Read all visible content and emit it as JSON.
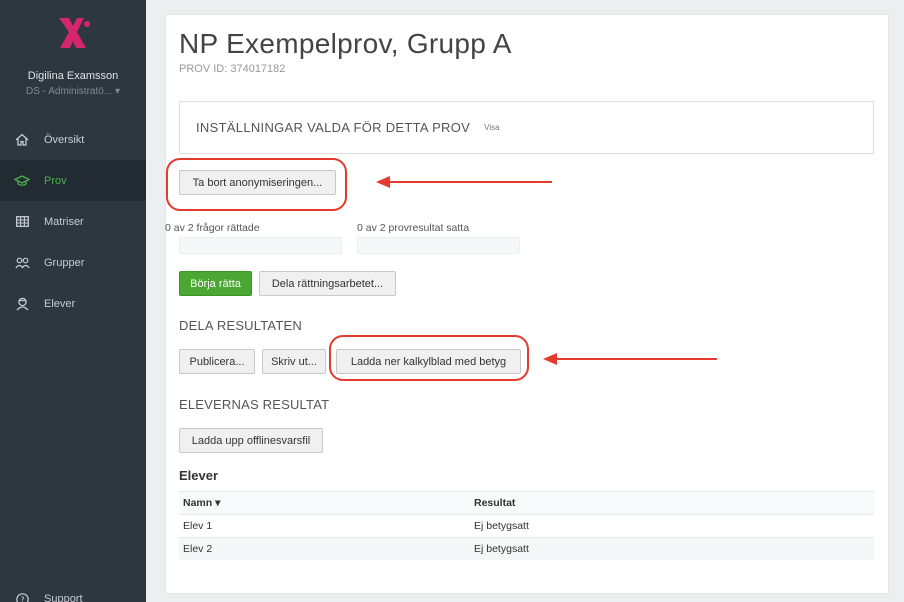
{
  "sidebar": {
    "user_name": "Digilina Examsson",
    "user_role": "DS - Administratö...",
    "items": [
      {
        "label": "Översikt",
        "icon": "home-icon",
        "active": false
      },
      {
        "label": "Prov",
        "icon": "graduation-cap-icon",
        "active": true
      },
      {
        "label": "Matriser",
        "icon": "grid-icon",
        "active": false
      },
      {
        "label": "Grupper",
        "icon": "group-icon",
        "active": false
      },
      {
        "label": "Elever",
        "icon": "student-icon",
        "active": false
      }
    ],
    "support_label": "Support"
  },
  "header": {
    "title": "NP Exempelprov, Grupp A",
    "subtitle": "PROV ID: 374017182"
  },
  "settings": {
    "title": "INSTÄLLNINGAR VALDA FÖR DETTA PROV",
    "link": "Visa"
  },
  "anonymize_button": "Ta bort anonymiseringen...",
  "progress": {
    "questions_label": "0 av 2 frågor rättade",
    "questions_fraction": 0,
    "results_label": "0 av 2 provresultat satta",
    "results_fraction": 0
  },
  "grading": {
    "start_button": "Börja rätta",
    "share_button": "Dela rättningsarbetet..."
  },
  "share_results": {
    "heading": "DELA RESULTATEN",
    "publish_button": "Publicera...",
    "print_button": "Skriv ut...",
    "download_button": "Ladda ner kalkylblad med betyg"
  },
  "student_results": {
    "heading": "ELEVERNAS RESULTAT",
    "upload_button": "Ladda upp offlinesvarsfil"
  },
  "students_table": {
    "heading": "Elever",
    "columns": {
      "name": "Namn ▾",
      "result": "Resultat"
    },
    "rows": [
      {
        "name": "Elev 1",
        "result": "Ej betygsatt"
      },
      {
        "name": "Elev 2",
        "result": "Ej betygsatt"
      }
    ]
  },
  "colors": {
    "sidebar_bg": "#2d3740",
    "accent_green": "#4aa832",
    "annotation_red": "#e53a2e",
    "logo_pink": "#d6266b"
  }
}
